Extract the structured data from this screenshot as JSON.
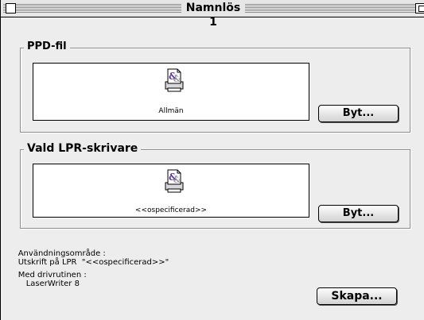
{
  "window": {
    "title": "Namnlös 1"
  },
  "ppd_group": {
    "legend": "PPD-fil",
    "item_label": "Allmän",
    "change_button": "Byt..."
  },
  "lpr_group": {
    "legend": "Vald LPR-skrivare",
    "item_label": "<<ospecificerad>>",
    "change_button": "Byt..."
  },
  "info": {
    "usage_label": "Användningsområde :",
    "usage_value": "Utskrift på LPR  \"<<ospecificerad>>\"",
    "driver_label": "Med drivrutinen :",
    "driver_value": "LaserWriter 8"
  },
  "create_button": "Skapa...",
  "icons": {
    "printer_description": "printer-description-file-icon"
  }
}
